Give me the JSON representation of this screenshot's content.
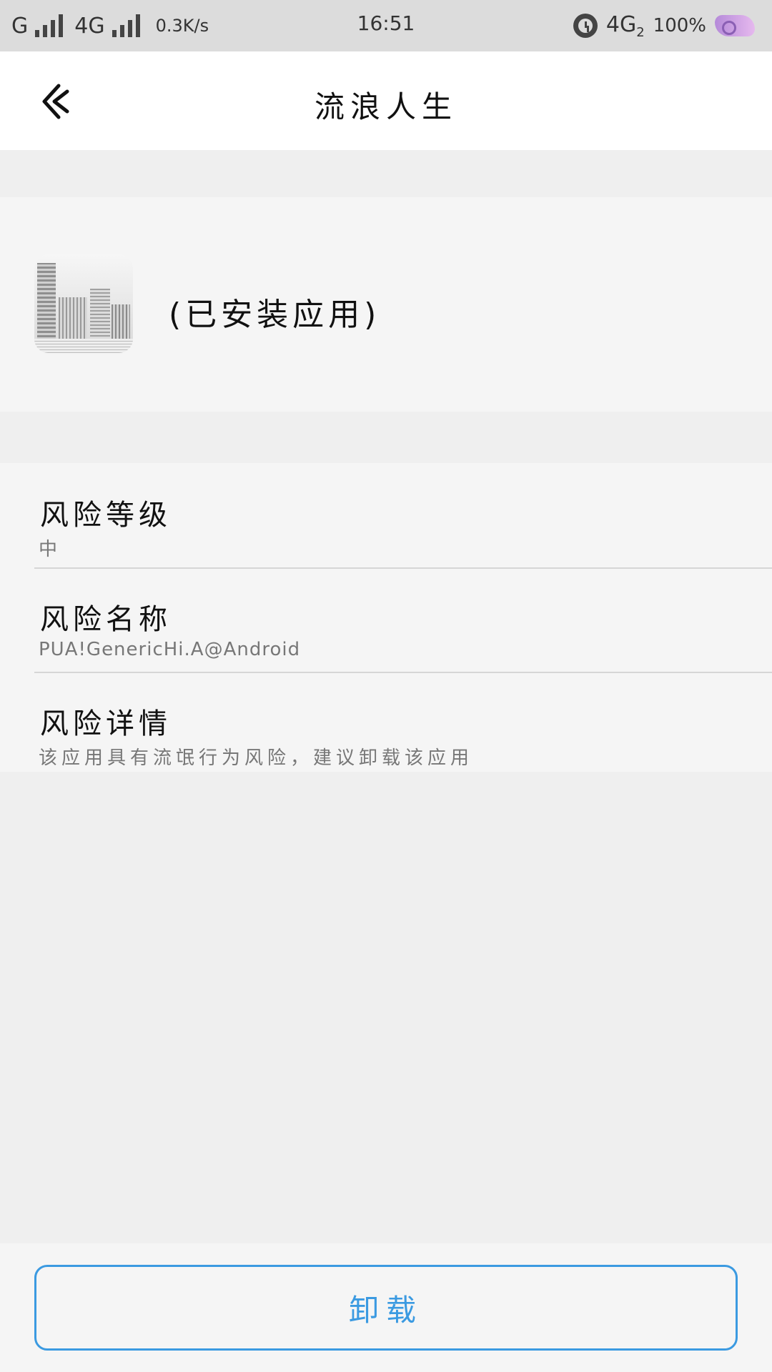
{
  "status_bar": {
    "network_1": "G",
    "network_2": "4G",
    "speed": "0.3K/s",
    "time": "16:51",
    "network_3": "4G",
    "network_3_sub": "2",
    "battery": "100%"
  },
  "header": {
    "title": "流浪人生",
    "back_icon": "chevron-left-icon"
  },
  "app": {
    "status": "(已安装应用)",
    "icon": "city-buildings-sketch"
  },
  "risk": {
    "level_label": "风险等级",
    "level_value": "中",
    "name_label": "风险名称",
    "name_value": "PUA!GenericHi.A@Android",
    "detail_label": "风险详情",
    "detail_value": "该应用具有流氓行为风险，建议卸载该应用"
  },
  "actions": {
    "uninstall_label": "卸载"
  },
  "colors": {
    "accent": "#3b9ae1",
    "background": "#efefef",
    "card": "#f5f5f5",
    "header": "#ffffff",
    "status_bar": "#dcdcdc"
  }
}
